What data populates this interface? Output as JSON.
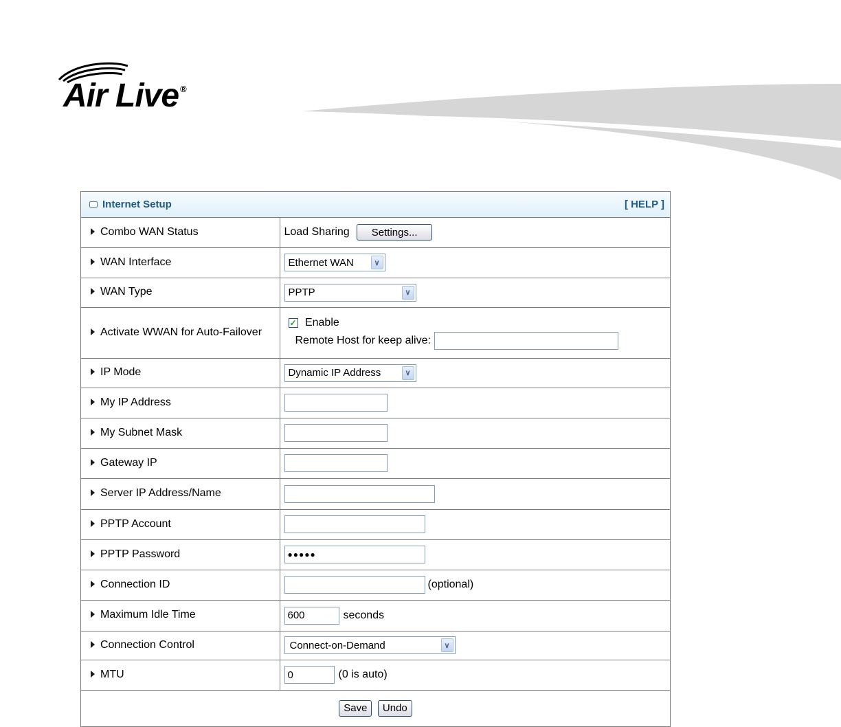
{
  "brand": {
    "name": "Air Live",
    "reg_mark": "®"
  },
  "panel": {
    "title": "Internet Setup",
    "help_label": "[ HELP ]"
  },
  "rows": {
    "combo_wan": {
      "label": "Combo WAN Status",
      "value": "Load Sharing",
      "button": "Settings..."
    },
    "wan_interface": {
      "label": "WAN Interface",
      "selected": "Ethernet WAN"
    },
    "wan_type": {
      "label": "WAN Type",
      "selected": "PPTP"
    },
    "wwan_failover": {
      "label": "Activate WWAN for Auto-Failover",
      "enable_label": "Enable",
      "enabled": true,
      "remote_host_label": "Remote Host for keep alive:",
      "remote_host_value": ""
    },
    "ip_mode": {
      "label": "IP Mode",
      "selected": "Dynamic IP Address"
    },
    "my_ip": {
      "label": "My IP Address",
      "value": ""
    },
    "subnet_mask": {
      "label": "My Subnet Mask",
      "value": ""
    },
    "gateway_ip": {
      "label": "Gateway IP",
      "value": ""
    },
    "server_ip": {
      "label": "Server IP Address/Name",
      "value": ""
    },
    "pptp_account": {
      "label": "PPTP Account",
      "value": ""
    },
    "pptp_password": {
      "label": "PPTP Password",
      "value": "●●●●●"
    },
    "connection_id": {
      "label": "Connection ID",
      "value": "",
      "suffix": "(optional)"
    },
    "max_idle": {
      "label": "Maximum Idle Time",
      "value": "600",
      "suffix": "seconds"
    },
    "connection_control": {
      "label": "Connection Control",
      "selected": "Connect-on-Demand"
    },
    "mtu": {
      "label": "MTU",
      "value": "0",
      "suffix": "(0 is auto)"
    }
  },
  "actions": {
    "save": "Save",
    "undo": "Undo"
  },
  "icons": {
    "row_marker": "triangle-right-icon",
    "dropdown": "chevron-down-icon",
    "check": "checkmark-icon"
  },
  "colors": {
    "header_text": "#1f5a86",
    "border": "#7a7a7a",
    "header_bg": "#dff0f9"
  }
}
